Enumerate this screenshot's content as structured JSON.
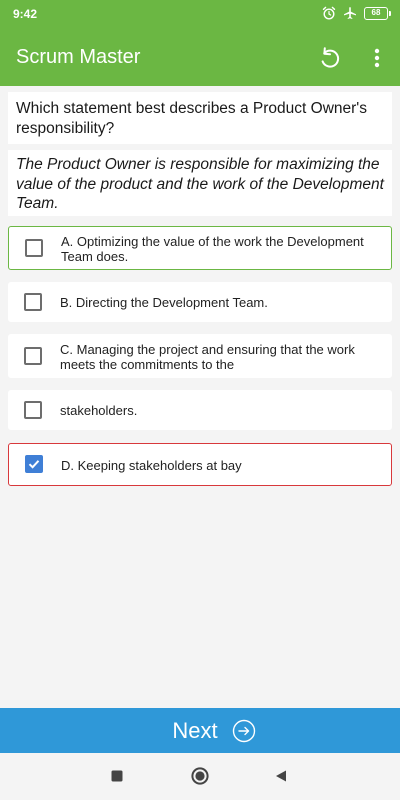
{
  "status_bar": {
    "time": "9:42",
    "battery_level": "68",
    "icons": [
      "alarm-icon",
      "airplane-mode-icon",
      "battery-icon"
    ]
  },
  "app_bar": {
    "title": "Scrum Master",
    "actions": [
      "reset-icon",
      "more-vert-icon"
    ]
  },
  "question": {
    "text": "Which statement best describes a Product Owner's responsibility?",
    "prompt": "The Product Owner is responsible for maximizing the value of the product and the work of the Development Team."
  },
  "options": [
    {
      "label": "A.  Optimizing the value of the work the Development Team does.",
      "checked": false,
      "state": "correct"
    },
    {
      "label": "B.  Directing the Development Team.",
      "checked": false,
      "state": "none"
    },
    {
      "label": "C.  Managing the project and ensuring that the work meets the commitments to the",
      "checked": false,
      "state": "none"
    },
    {
      "label": "stakeholders.",
      "checked": false,
      "state": "none"
    },
    {
      "label": "D.  Keeping stakeholders at bay",
      "checked": true,
      "state": "incorrect"
    }
  ],
  "next_button": {
    "label": "Next",
    "icon": "arrow-right-circle-icon"
  },
  "colors": {
    "primary": "#6bb743",
    "next_bar": "#2f98d8",
    "correct_border": "#6bb743",
    "incorrect_border": "#d8383b",
    "checkbox_checked": "#3f7fd6"
  }
}
